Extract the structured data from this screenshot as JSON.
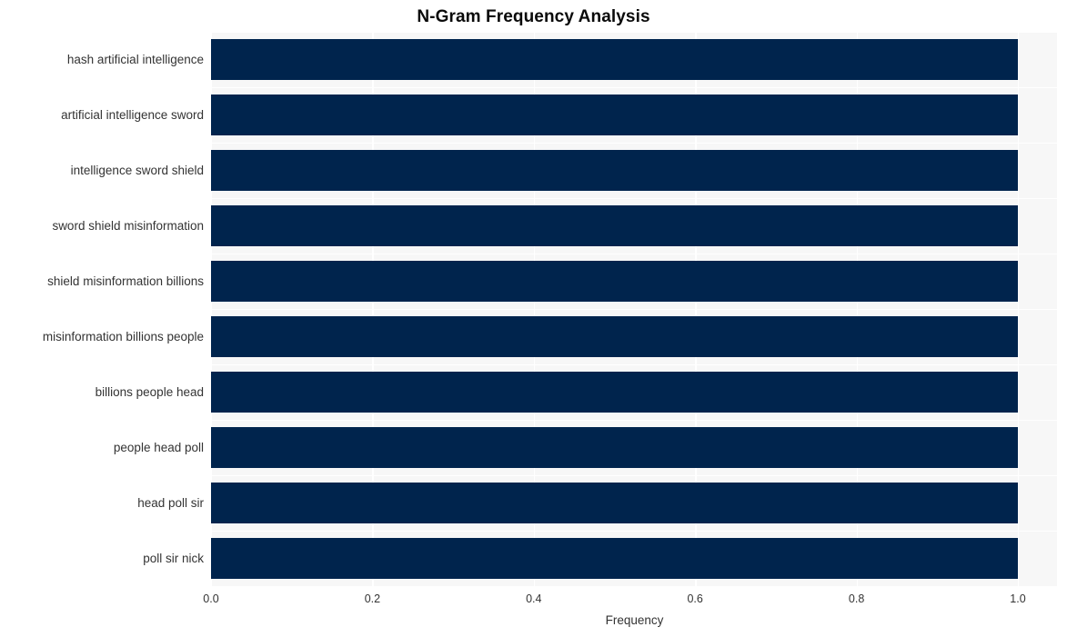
{
  "chart_data": {
    "type": "bar",
    "orientation": "horizontal",
    "title": "N-Gram Frequency Analysis",
    "xlabel": "Frequency",
    "ylabel": "",
    "categories": [
      "hash artificial intelligence",
      "artificial intelligence sword",
      "intelligence sword shield",
      "sword shield misinformation",
      "shield misinformation billions",
      "misinformation billions people",
      "billions people head",
      "people head poll",
      "head poll sir",
      "poll sir nick"
    ],
    "values": [
      1.0,
      1.0,
      1.0,
      1.0,
      1.0,
      1.0,
      1.0,
      1.0,
      1.0,
      1.0
    ],
    "xlim": [
      0.0,
      1.0
    ],
    "xticks": [
      0.0,
      0.2,
      0.4,
      0.6,
      0.8,
      1.0
    ],
    "xticklabels": [
      "0.0",
      "0.2",
      "0.4",
      "0.6",
      "0.8",
      "1.0"
    ],
    "grid": true,
    "legend": null,
    "bar_color": "#00244d",
    "plot_background": "#f7f7f7",
    "gridline_color": "#ffffff",
    "figure_background": "#ffffff",
    "text_color": "#333333",
    "title_color": "#0a0a0a"
  }
}
